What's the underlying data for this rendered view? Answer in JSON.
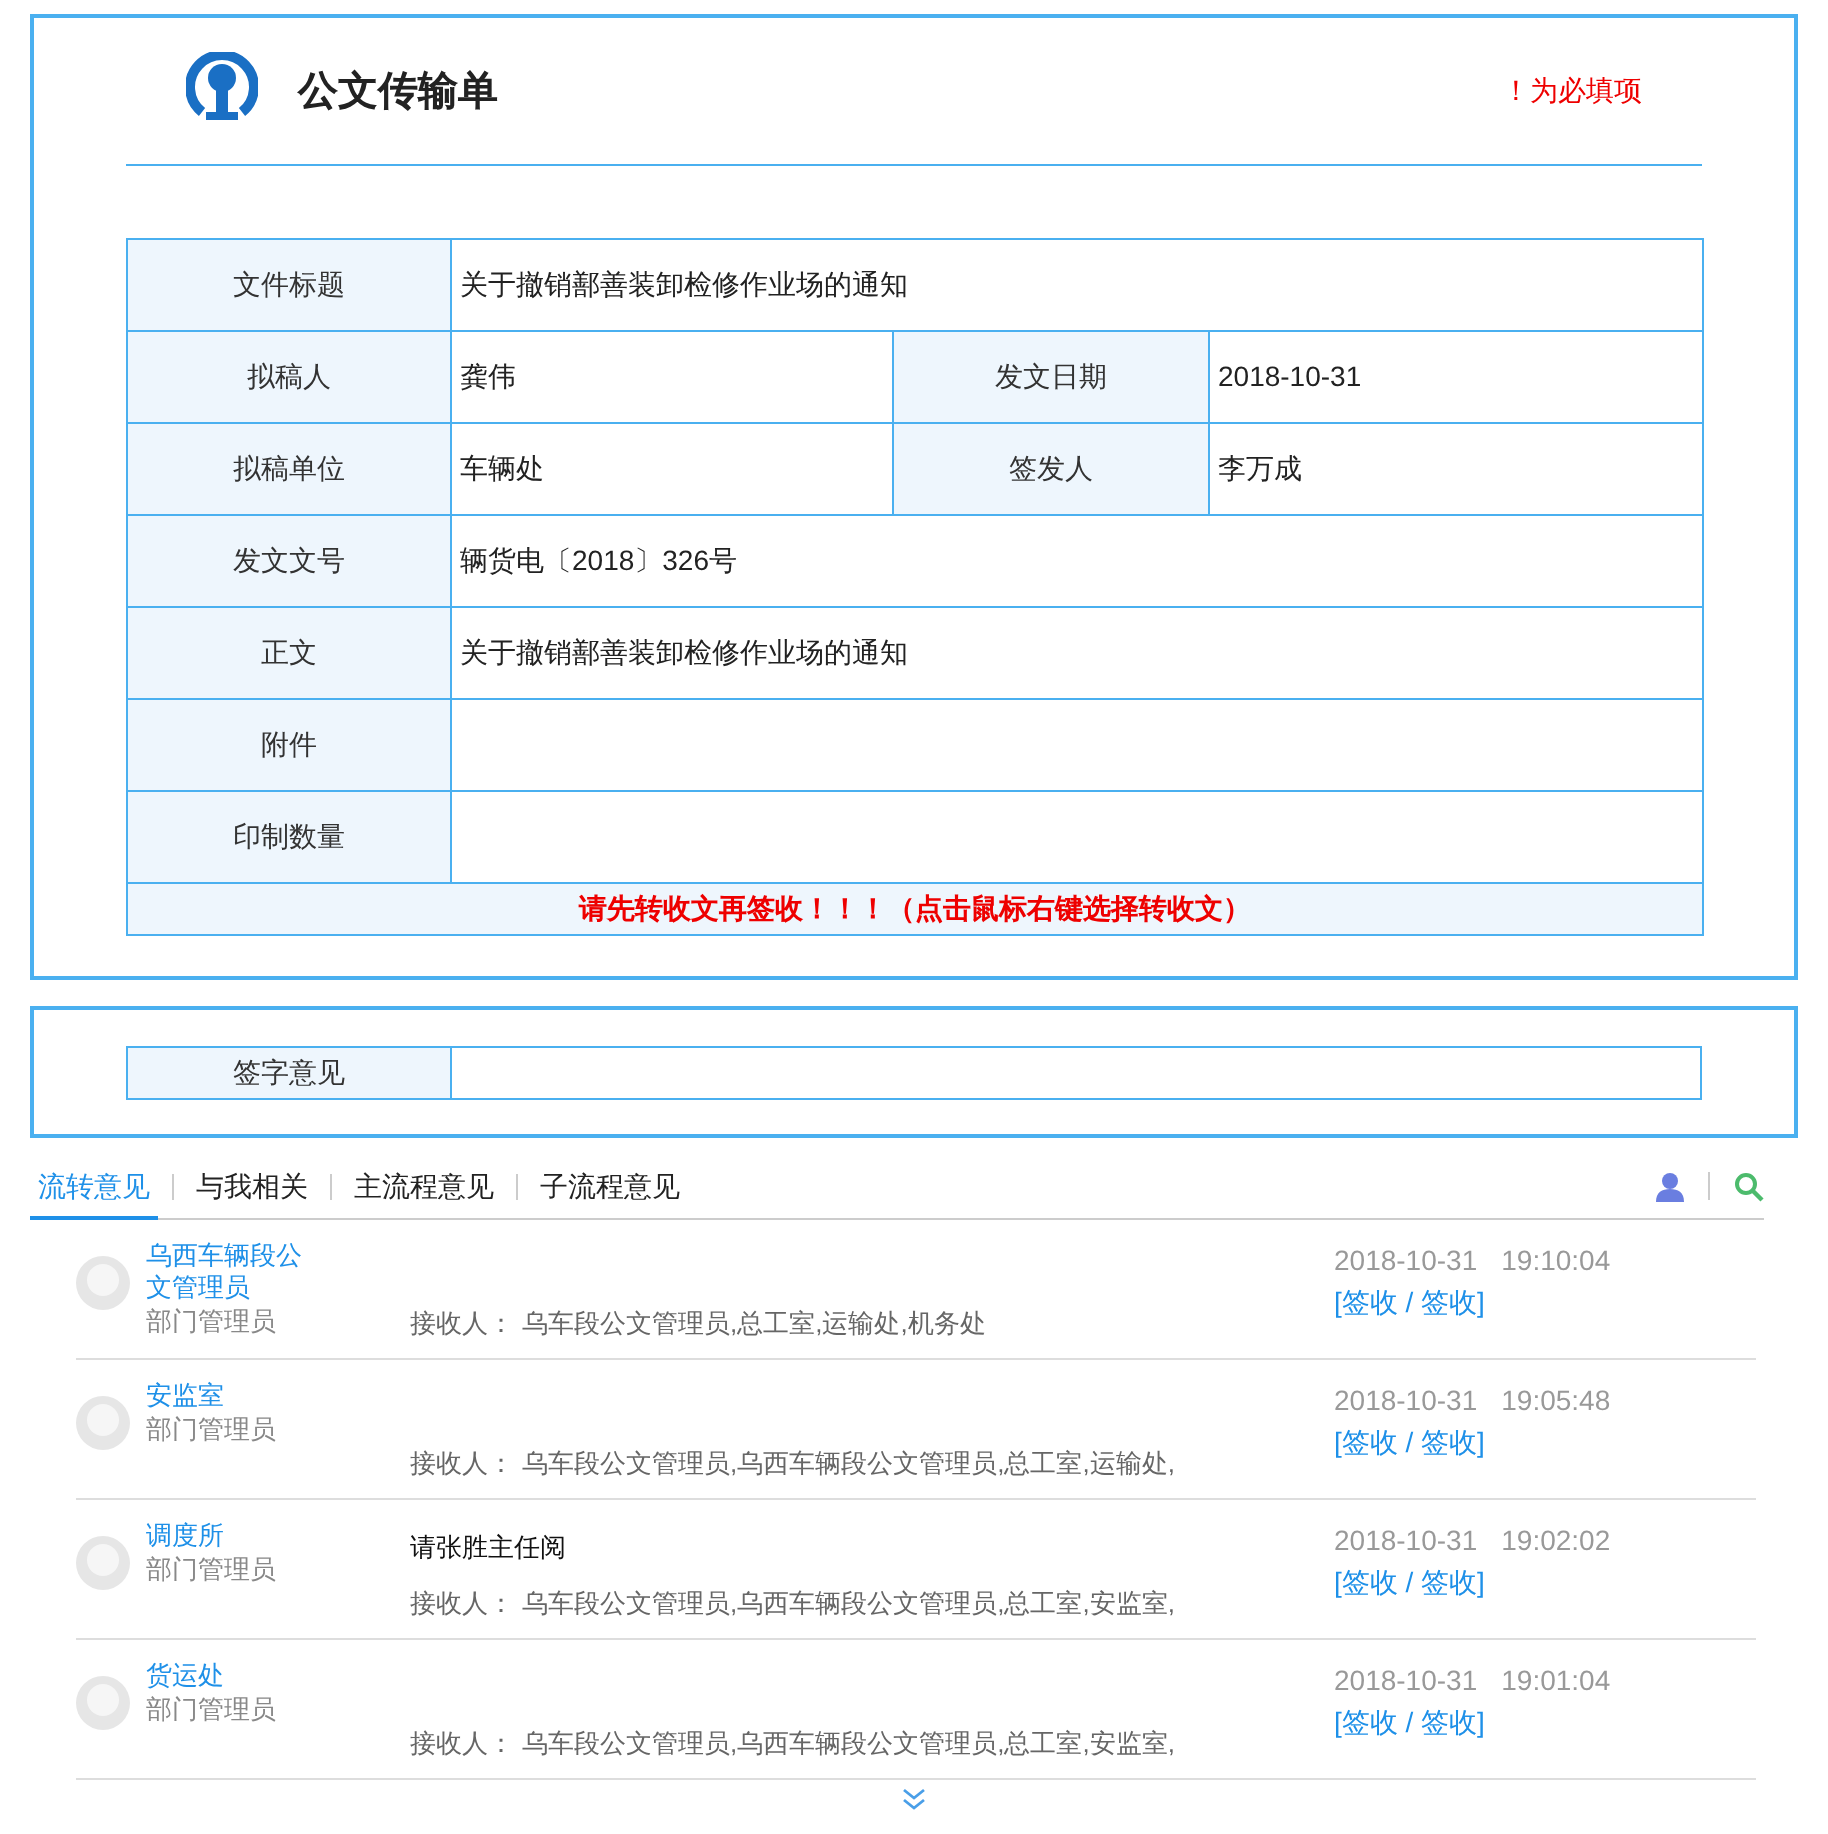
{
  "header": {
    "title": "公文传输单",
    "required_note": "！为必填项"
  },
  "form": {
    "rows": [
      [
        {
          "label": "文件标题",
          "value": "关于撤销鄯善装卸检修作业场的通知"
        }
      ],
      [
        {
          "label": "拟稿人",
          "value": "龚伟"
        },
        {
          "label": "发文日期",
          "value": "2018-10-31"
        }
      ],
      [
        {
          "label": "拟稿单位",
          "value": "车辆处"
        },
        {
          "label": "签发人",
          "value": "李万成"
        }
      ],
      [
        {
          "label": "发文文号",
          "value": "辆货电〔2018〕326号"
        }
      ],
      [
        {
          "label": "正文",
          "value": "关于撤销鄯善装卸检修作业场的通知"
        }
      ],
      [
        {
          "label": "附件"
        }
      ],
      [
        {
          "label": "印制数量"
        }
      ]
    ],
    "notice": "请先转收文再签收！！！（点击鼠标右键选择转收文）"
  },
  "sign": {
    "label": "签字意见"
  },
  "tabs": [
    {
      "label": "流转意见",
      "selected": true
    },
    {
      "label": "与我相关",
      "selected": false
    },
    {
      "label": "主流程意见",
      "selected": false
    },
    {
      "label": "子流程意见",
      "selected": false
    }
  ],
  "comments": [
    {
      "name": "乌西车辆段公文管理员",
      "role": "部门管理员",
      "recipients_label": "接收人：",
      "recipients": "乌车段公文管理员,总工室,运输处,机务处",
      "date": "2018-10-31",
      "time": "19:10:04",
      "action": "[签收 / 签收]"
    },
    {
      "name": "安监室",
      "role": "部门管理员",
      "recipients_label": "接收人：",
      "recipients": "乌车段公文管理员,乌西车辆段公文管理员,总工室,运输处,",
      "date": "2018-10-31",
      "time": "19:05:48",
      "action": "[签收 / 签收]"
    },
    {
      "name": "调度所",
      "role": "部门管理员",
      "note": "请张胜主任阅",
      "recipients_label": "接收人：",
      "recipients": "乌车段公文管理员,乌西车辆段公文管理员,总工室,安监室,",
      "date": "2018-10-31",
      "time": "19:02:02",
      "action": "[签收 / 签收]"
    },
    {
      "name": "货运处",
      "role": "部门管理员",
      "recipients_label": "接收人：",
      "recipients": "乌车段公文管理员,乌西车辆段公文管理员,总工室,安监室,",
      "date": "2018-10-31",
      "time": "19:01:04",
      "action": "[签收 / 签收]"
    }
  ]
}
